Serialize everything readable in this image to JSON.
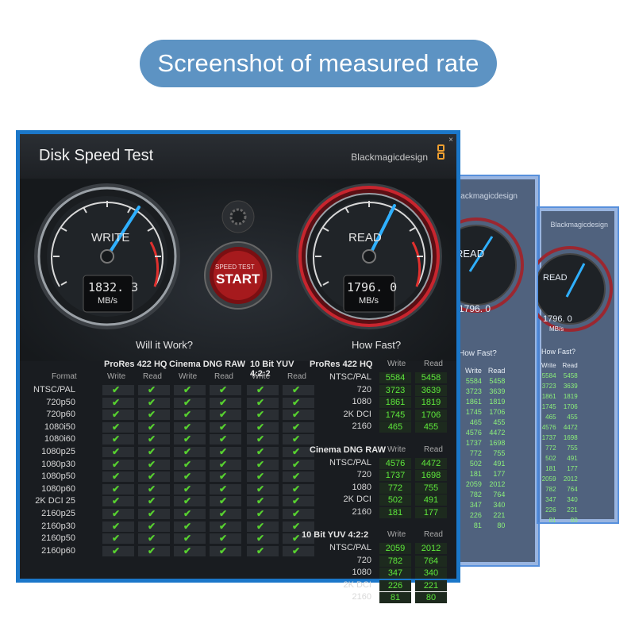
{
  "banner": "Screenshot of measured rate",
  "app": {
    "title": "Disk Speed Test",
    "brand": "Blackmagicdesign",
    "close": "×"
  },
  "write_gauge": {
    "label": "WRITE",
    "value": "1832. 3",
    "unit": "MB/s"
  },
  "read_gauge": {
    "label": "READ",
    "value": "1796. 0",
    "unit": "MB/s"
  },
  "start_button": {
    "top": "SPEED TEST",
    "main": "START"
  },
  "will_it_work": "Will it Work?",
  "how_fast": "How Fast?",
  "left_table": {
    "groups": [
      "ProRes 422 HQ",
      "Cinema DNG RAW",
      "10 Bit YUV 4:2:2"
    ],
    "format_label": "Format",
    "sub": [
      "Write",
      "Read",
      "Write",
      "Read",
      "Write",
      "Read"
    ],
    "rows": [
      "NTSC/PAL",
      "720p50",
      "720p60",
      "1080i50",
      "1080i60",
      "1080p25",
      "1080p30",
      "1080p50",
      "1080p60",
      "2K DCI 25",
      "2160p25",
      "2160p30",
      "2160p50",
      "2160p60"
    ],
    "check": "✔"
  },
  "right_table": {
    "col_write": "Write",
    "col_read": "Read",
    "sections": [
      {
        "name": "ProRes 422 HQ",
        "rows": [
          {
            "fmt": "NTSC/PAL",
            "w": "5584",
            "r": "5458"
          },
          {
            "fmt": "720",
            "w": "3723",
            "r": "3639"
          },
          {
            "fmt": "1080",
            "w": "1861",
            "r": "1819"
          },
          {
            "fmt": "2K DCI",
            "w": "1745",
            "r": "1706"
          },
          {
            "fmt": "2160",
            "w": "465",
            "r": "455"
          }
        ]
      },
      {
        "name": "Cinema DNG RAW",
        "rows": [
          {
            "fmt": "NTSC/PAL",
            "w": "4576",
            "r": "4472"
          },
          {
            "fmt": "720",
            "w": "1737",
            "r": "1698"
          },
          {
            "fmt": "1080",
            "w": "772",
            "r": "755"
          },
          {
            "fmt": "2K DCI",
            "w": "502",
            "r": "491"
          },
          {
            "fmt": "2160",
            "w": "181",
            "r": "177"
          }
        ]
      },
      {
        "name": "10 Bit YUV 4:2:2",
        "rows": [
          {
            "fmt": "NTSC/PAL",
            "w": "2059",
            "r": "2012"
          },
          {
            "fmt": "720",
            "w": "782",
            "r": "764"
          },
          {
            "fmt": "1080",
            "w": "347",
            "r": "340"
          },
          {
            "fmt": "2K DCI",
            "w": "226",
            "r": "221"
          },
          {
            "fmt": "2160",
            "w": "81",
            "r": "80"
          }
        ]
      }
    ]
  },
  "ghost1": {
    "brand": "Blackmagicdesign",
    "read": "READ",
    "value": "1796. 0",
    "how_fast": "How Fast?",
    "write": "Write",
    "read_col": "Read"
  },
  "ghost2": {
    "brand": "Blackmagicdesign",
    "read": "READ",
    "value": "1796. 0",
    "unit": "MB/s",
    "how_fast": "How Fast?",
    "write": "Write",
    "read_col": "Read"
  },
  "colors": {
    "accent": "#1b77c9",
    "banner": "#5d93c3",
    "check": "#57d12f",
    "value": "#5ee83c",
    "needle": "#2fb0ff",
    "read_ring": "#c8252e"
  }
}
